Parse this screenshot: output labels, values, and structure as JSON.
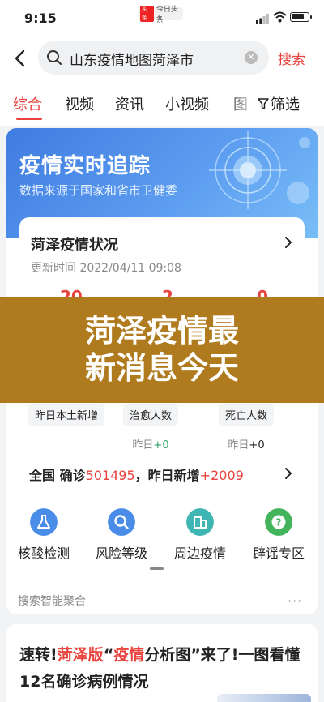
{
  "status_bar": {
    "time": "9:15",
    "toutiao_badge": "今日头条",
    "toutiao_logo": "头条"
  },
  "search": {
    "query": "山东疫情地图菏泽市",
    "button_label": "搜索"
  },
  "tabs": [
    {
      "label": "综合",
      "active": true
    },
    {
      "label": "视频"
    },
    {
      "label": "资讯"
    },
    {
      "label": "小视频"
    },
    {
      "label": "图"
    }
  ],
  "filter_label": "筛选",
  "banner": {
    "title": "疫情实时追踪",
    "subtitle": "数据来源于国家和省市卫健委"
  },
  "status_card": {
    "title": "菏泽疫情状况",
    "update_time": "更新时间 2022/04/11 09:08",
    "counts": [
      "20",
      "2",
      "0"
    ]
  },
  "overlay": {
    "line1": "菏泽疫情最",
    "line2": "新消息今天"
  },
  "stats": [
    {
      "label": "昨日本土新增",
      "change_prefix": "",
      "change_value": ""
    },
    {
      "label": "治愈人数",
      "change_prefix": "昨日",
      "change_value": "+0"
    },
    {
      "label": "死亡人数",
      "change_prefix": "昨日",
      "change_value": "+0"
    }
  ],
  "national": {
    "prefix": "全国 确诊",
    "confirmed": "501495",
    "mid": "，昨日新增",
    "new_cases": "+2009"
  },
  "quick_links": [
    {
      "label": "核酸检测",
      "icon": "flask-icon",
      "color": "#4a8de8"
    },
    {
      "label": "风险等级",
      "icon": "magnifier-icon",
      "color": "#4a8de8"
    },
    {
      "label": "周边疫情",
      "icon": "buildings-icon",
      "color": "#3fb6b4"
    },
    {
      "label": "辟谣专区",
      "icon": "question-icon",
      "color": "#43b35c"
    }
  ],
  "smart_aggregate_label": "搜索智能聚合",
  "more_label": "···",
  "article": {
    "part1": "速转!",
    "part2": "菏泽版",
    "part3": "“",
    "part4": "疫情",
    "part5": "分析图”来了!一图看懂12名确诊病例情况"
  }
}
